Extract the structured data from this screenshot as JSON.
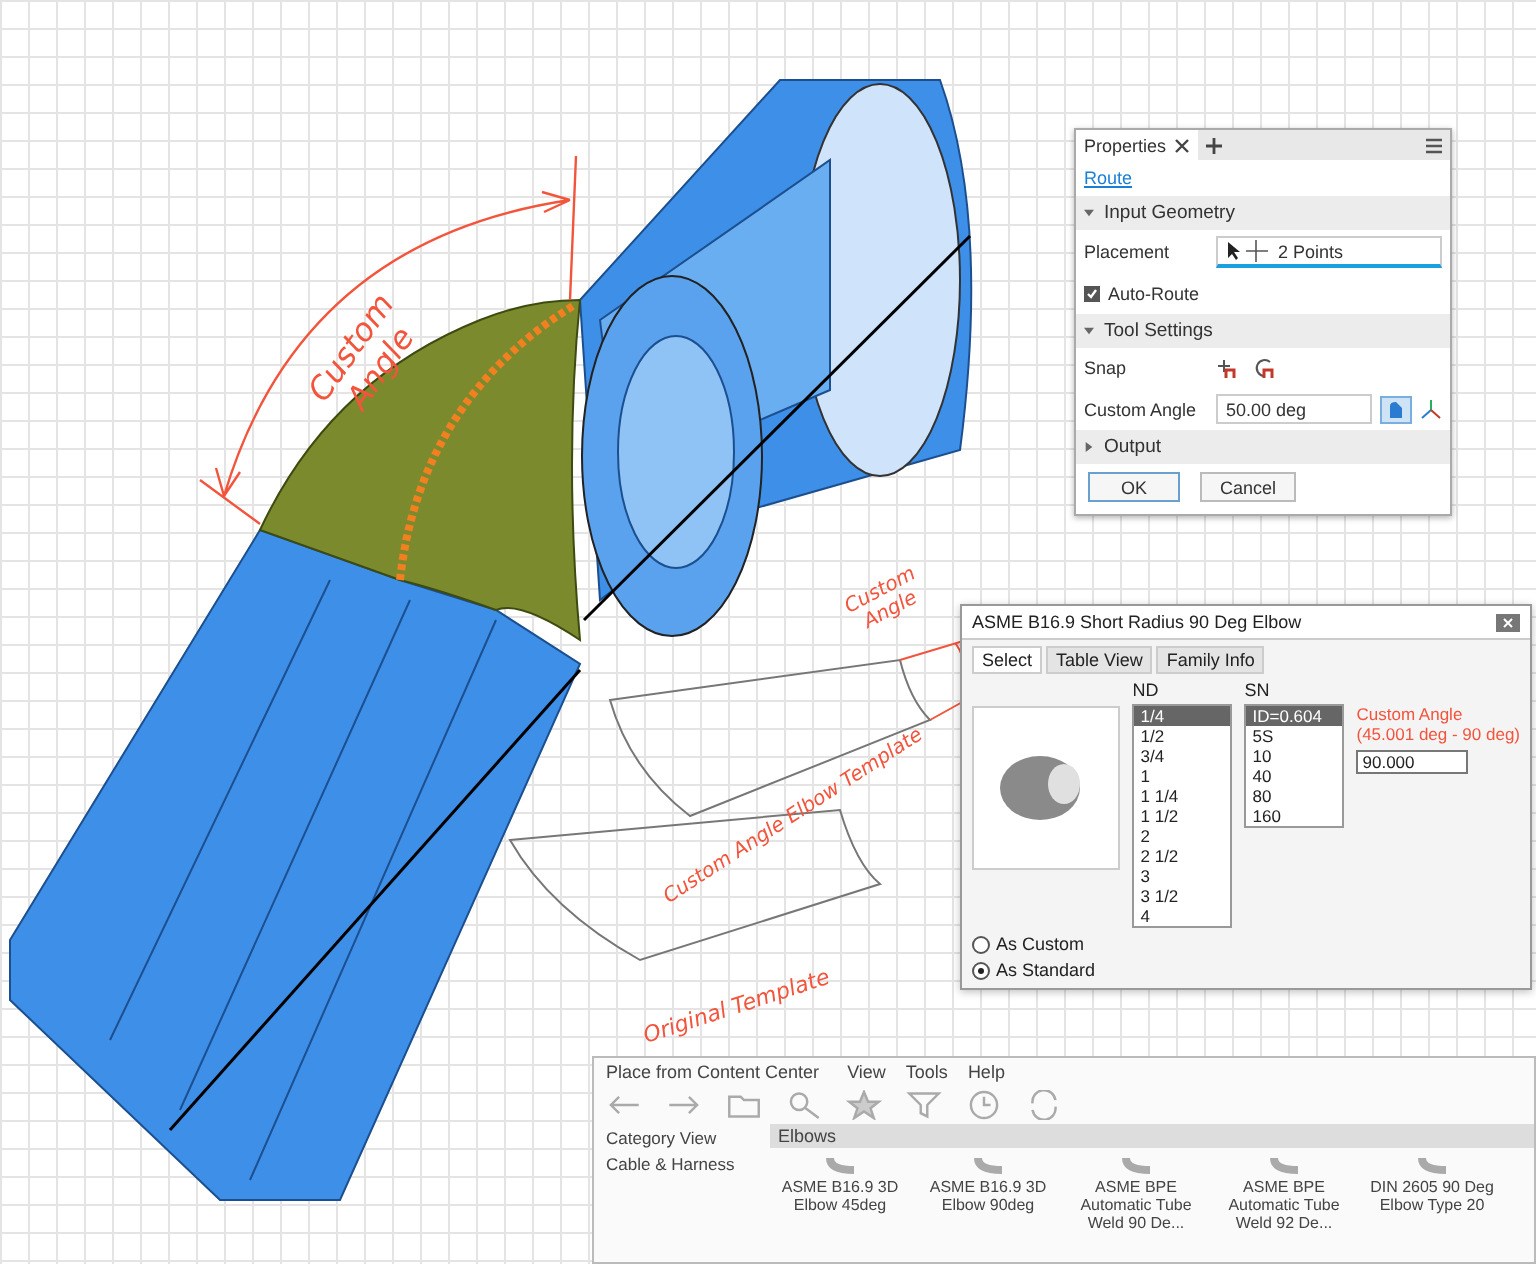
{
  "annotations": [
    {
      "kind": "main",
      "text": "Custom Angle"
    },
    {
      "kind": "template",
      "text": "Custom Angle"
    },
    {
      "kind": "elbow",
      "text": "Custom Angle Elbow Template"
    },
    {
      "kind": "original",
      "text": "Original Template"
    }
  ],
  "properties": {
    "tab": "Properties",
    "link": "Route",
    "buttons": [
      "OK",
      "Cancel"
    ],
    "sections": [
      {
        "title": "Input Geometry",
        "expanded": true,
        "rows": [
          {
            "kind": "select",
            "label": "Placement",
            "value": "2 Points"
          },
          {
            "kind": "checkbox",
            "label": "Auto-Route",
            "checked": true
          }
        ]
      },
      {
        "title": "Tool Settings",
        "expanded": true,
        "rows": [
          {
            "kind": "snap",
            "label": "Snap"
          },
          {
            "kind": "input",
            "label": "Custom Angle",
            "value": "50.00 deg"
          }
        ]
      },
      {
        "title": "Output",
        "expanded": false
      }
    ]
  },
  "family_dialog": {
    "title": "ASME B16.9 Short Radius 90 Deg Elbow",
    "tabs": [
      {
        "label": "Select",
        "selected": true
      },
      {
        "label": "Table View",
        "selected": false
      },
      {
        "label": "Family Info",
        "selected": false
      }
    ],
    "columns": [
      "ND",
      "SN"
    ],
    "nd_values": [
      {
        "label": "1/4",
        "selected": true
      },
      {
        "label": "1/2",
        "selected": false
      },
      {
        "label": "3/4",
        "selected": false
      },
      {
        "label": "1",
        "selected": false
      },
      {
        "label": "1 1/4",
        "selected": false
      },
      {
        "label": "1 1/2",
        "selected": false
      },
      {
        "label": "2",
        "selected": false
      },
      {
        "label": "2 1/2",
        "selected": false
      },
      {
        "label": "3",
        "selected": false
      },
      {
        "label": "3 1/2",
        "selected": false
      },
      {
        "label": "4",
        "selected": false
      }
    ],
    "sn_values": [
      {
        "label": "ID=0.604",
        "selected": true
      },
      {
        "label": "5S",
        "selected": false
      },
      {
        "label": "10",
        "selected": false
      },
      {
        "label": "40",
        "selected": false
      },
      {
        "label": "80",
        "selected": false
      },
      {
        "label": "160",
        "selected": false
      }
    ],
    "custom_angle_label": "Custom Angle (45.001 deg - 90 deg)",
    "custom_angle_value": "90.000",
    "radios": [
      {
        "label": "As Custom",
        "selected": false
      },
      {
        "label": "As Standard",
        "selected": true
      }
    ]
  },
  "content_center": {
    "title": "Place from Content Center",
    "menu": [
      "View",
      "Tools",
      "Help"
    ],
    "category": "Elbows",
    "tree": [
      "Category View",
      "Cable & Harness"
    ],
    "items": [
      "ASME B16.9 3D Elbow 45deg",
      "ASME B16.9 3D Elbow 90deg",
      "ASME BPE Automatic Tube Weld 90 De...",
      "ASME BPE Automatic Tube Weld 92 De...",
      "DIN 2605 90 Deg Elbow Type 20"
    ]
  }
}
